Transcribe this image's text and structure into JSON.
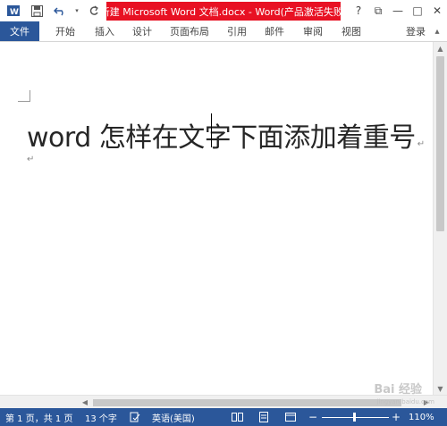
{
  "title": "新建 Microsoft Word 文档.docx - Word(产品激活失败)",
  "window_controls": {
    "help": "?",
    "restore": "⧉",
    "minimize": "—",
    "maximize": "□",
    "close": "✕"
  },
  "ribbon": {
    "file_tab": "文件",
    "tabs": [
      "开始",
      "插入",
      "设计",
      "页面布局",
      "引用",
      "邮件",
      "审阅",
      "视图"
    ],
    "signin": "登录"
  },
  "document": {
    "heading": "word 怎样在文字下面添加着重号",
    "paragraph_mark": "↵"
  },
  "status": {
    "page": "第 1 页，共 1 页",
    "words": "13 个字",
    "language": "英语(美国)",
    "zoom_minus": "−",
    "zoom_plus": "+",
    "zoom": "110%"
  },
  "watermark": {
    "brand": "Bai 经验",
    "url": "jingyan.baidu.com"
  },
  "colors": {
    "brand": "#2b579a",
    "title_highlight": "#e81123"
  }
}
